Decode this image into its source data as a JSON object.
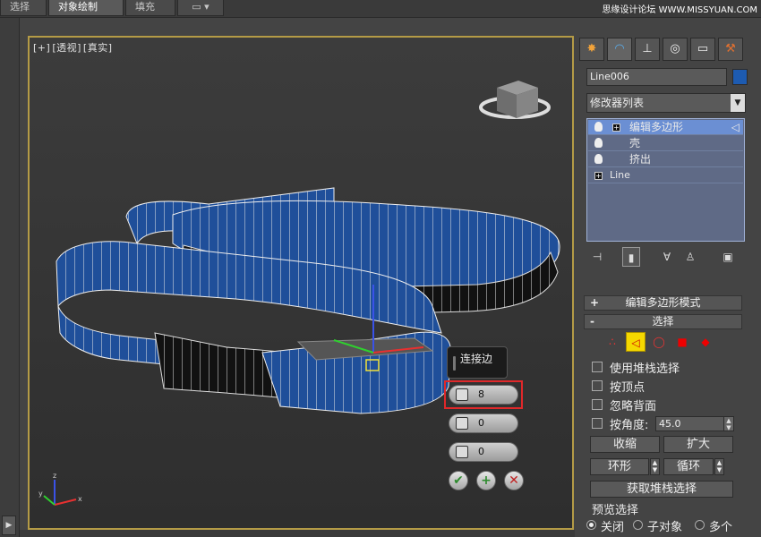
{
  "top_tabs": [
    "选择",
    "对象绘制",
    "填充"
  ],
  "watermark": "思缘设计论坛 WWW.MISSYUAN.COM",
  "viewport": {
    "labels": [
      "[+]",
      "[透视]",
      "[真实]"
    ]
  },
  "caddy": {
    "title": "连接边",
    "fields": [
      {
        "icon": "segments-icon",
        "value": "8"
      },
      {
        "icon": "pinch-icon",
        "value": "0"
      },
      {
        "icon": "slide-icon",
        "value": "0"
      }
    ],
    "buttons": [
      "✔",
      "+",
      "✕"
    ]
  },
  "command_panel": {
    "tabs": [
      "✸",
      "◠",
      "⊥",
      "◎",
      "▭",
      "⚒"
    ],
    "object_name": "Line006",
    "object_color": "#1d5bb1",
    "modifier_list": "修改器列表",
    "stack": [
      {
        "label": "编辑多边形",
        "selected": true
      },
      {
        "label": "壳",
        "selected": false
      },
      {
        "label": "挤出",
        "selected": false
      },
      {
        "label": "Line",
        "selected": false
      }
    ],
    "rollouts": {
      "edit_mode": "编辑多边形模式",
      "selection": "选择"
    },
    "checks": [
      "使用堆栈选择",
      "按顶点",
      "忽略背面",
      "按角度:"
    ],
    "angle_value": "45.0",
    "buttons": {
      "shrink": "收缩",
      "grow": "扩大",
      "ring": "环形",
      "loop": "循环",
      "get_stack": "获取堆栈选择"
    },
    "preview": {
      "label": "预览选择",
      "options": [
        "关闭",
        "子对象",
        "多个"
      ]
    }
  }
}
